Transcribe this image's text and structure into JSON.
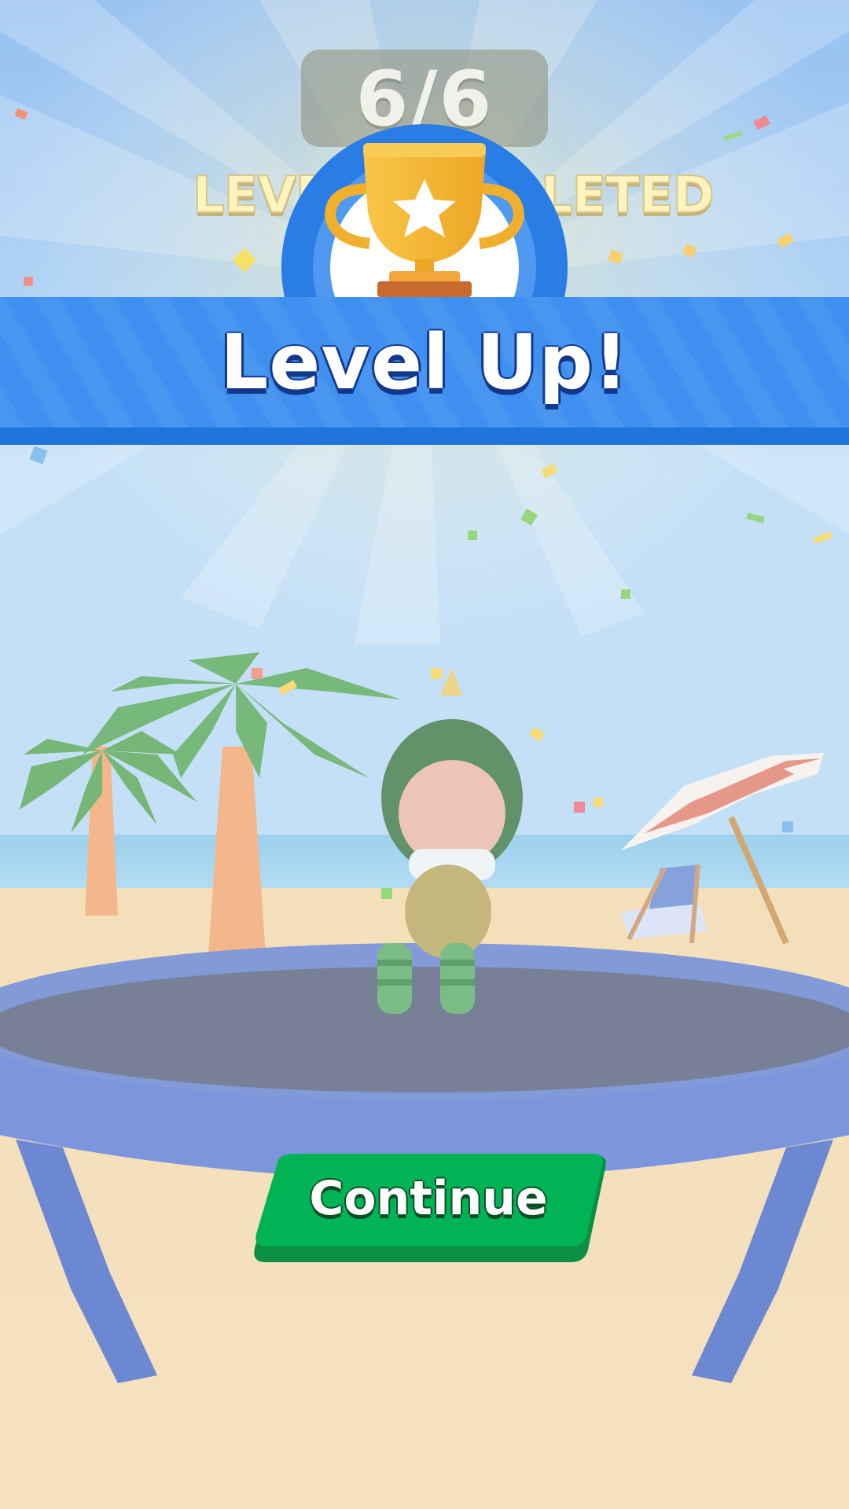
{
  "progress": {
    "text": "6/6",
    "current": 6,
    "total": 6
  },
  "status": {
    "text": "LEVEL COMPLETED"
  },
  "banner": {
    "title": "Level Up!"
  },
  "buttons": {
    "continue_label": "Continue"
  },
  "icons": {
    "trophy": "trophy-icon",
    "star": "star-icon"
  },
  "colors": {
    "sky": "#8ec2f0",
    "banner_blue": "#3e8ff0",
    "banner_border": "#1f74dc",
    "button_green": "#00b455",
    "button_shadow": "#0a8a3e",
    "sand": "#f1d7a9",
    "trophy_gold": "#f6b62d"
  }
}
